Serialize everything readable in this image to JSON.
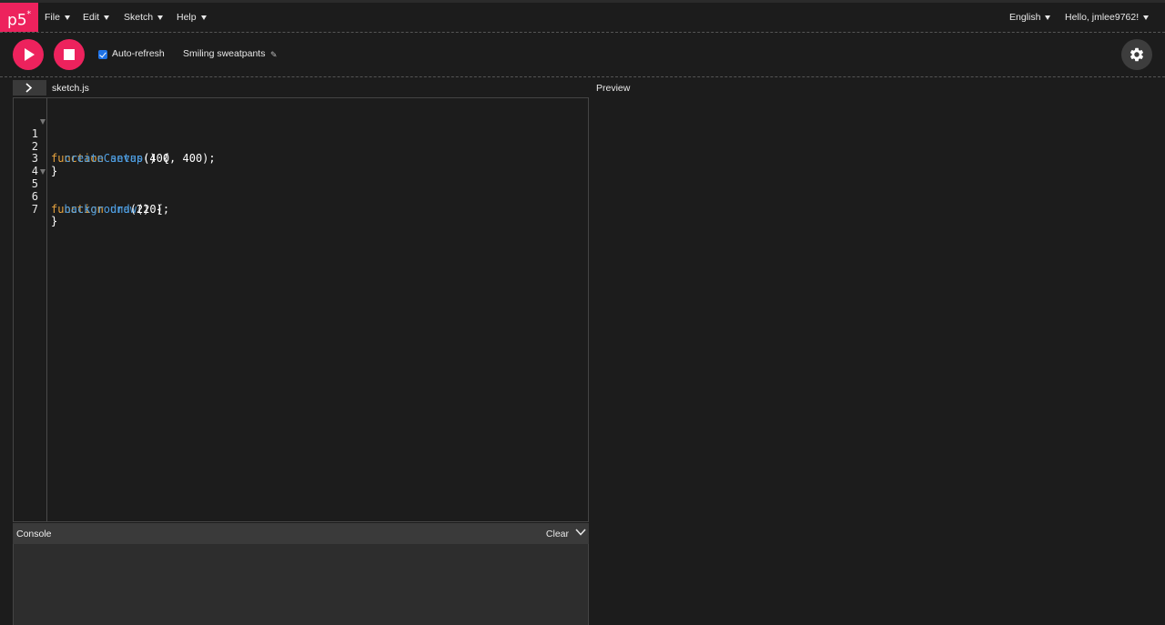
{
  "logo": {
    "text": "p5",
    "sup": "*"
  },
  "nav": {
    "menus": [
      {
        "label": "File"
      },
      {
        "label": "Edit"
      },
      {
        "label": "Sketch"
      },
      {
        "label": "Help"
      }
    ],
    "language": "English",
    "user_greeting": "Hello, jmlee9762!"
  },
  "toolbar": {
    "auto_refresh_label": "Auto-refresh",
    "auto_refresh_checked": true,
    "sketch_name": "Smiling sweatpants",
    "edit_icon": "pencil-icon",
    "settings_icon": "gear-icon"
  },
  "editor": {
    "tab_name": "sketch.js",
    "lines": [
      {
        "n": "1",
        "fold": true
      },
      {
        "n": "2",
        "fold": false
      },
      {
        "n": "3",
        "fold": false
      },
      {
        "n": "4",
        "fold": false
      },
      {
        "n": "5",
        "fold": true
      },
      {
        "n": "6",
        "fold": false
      },
      {
        "n": "7",
        "fold": false
      }
    ],
    "code": {
      "l1_kw": "function",
      "l1_fn": "setup",
      "l1_rest": "() {",
      "l2_indent": "  ",
      "l2_fn": "createCanvas",
      "l2_rest": "(400, 400);",
      "l3": "}",
      "l4": "",
      "l5_kw": "function",
      "l5_fn": "draw",
      "l5_rest": "() {",
      "l6_indent": "  ",
      "l6_fn": "background",
      "l6_rest": "(220);",
      "l7": "}"
    }
  },
  "preview": {
    "label": "Preview"
  },
  "console": {
    "title": "Console",
    "clear_label": "Clear"
  },
  "colors": {
    "accent": "#ed225d",
    "keyword": "#e7a33e",
    "function": "#4e9de0",
    "background": "#1c1c1c"
  }
}
